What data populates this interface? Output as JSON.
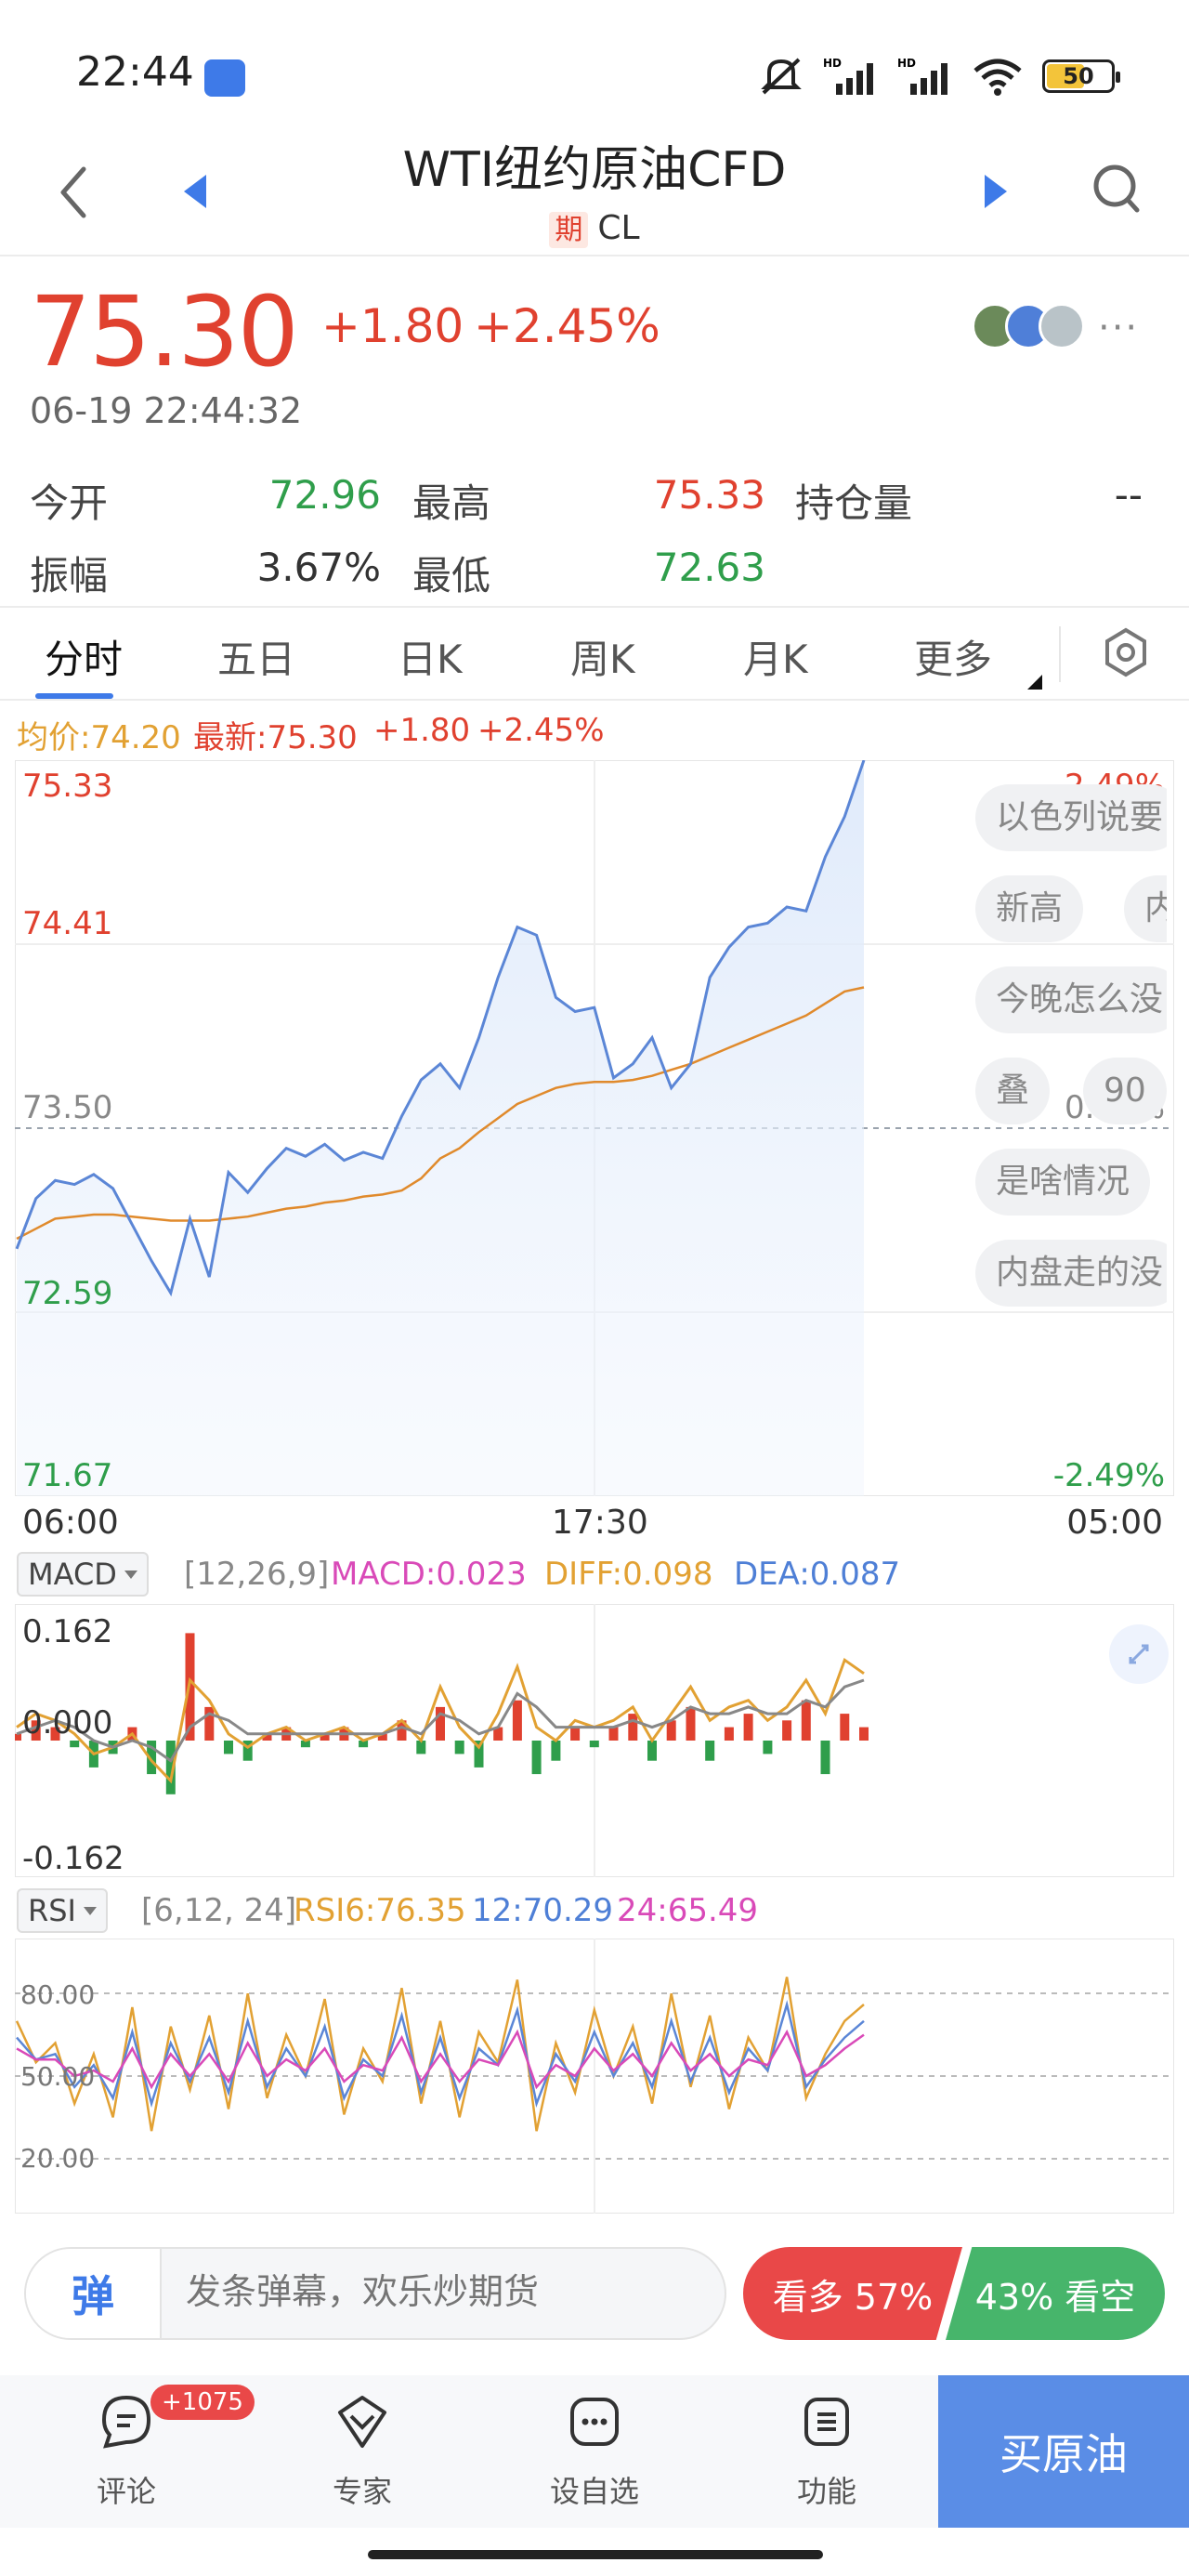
{
  "status_bar": {
    "time": "22:44",
    "battery": "50",
    "icons": [
      "mute-icon",
      "signal-hd-icon",
      "signal-hd-icon",
      "wifi-icon",
      "battery-icon"
    ]
  },
  "header": {
    "title": "WTI纽约原油CFD",
    "tag": "期",
    "code": "CL"
  },
  "quote": {
    "price": "75.30",
    "change": "+1.80",
    "change_pct": "+2.45%",
    "datetime": "06-19 22:44:32",
    "more": "···"
  },
  "stats": {
    "open_label": "今开",
    "open": "72.96",
    "high_label": "最高",
    "high": "75.33",
    "oi_label": "持仓量",
    "oi": "--",
    "amp_label": "振幅",
    "amp": "3.67%",
    "low_label": "最低",
    "low": "72.63"
  },
  "tabs": [
    {
      "label": "分时"
    },
    {
      "label": "五日"
    },
    {
      "label": "日K"
    },
    {
      "label": "周K"
    },
    {
      "label": "月K"
    },
    {
      "label": "更多"
    }
  ],
  "legend": {
    "avg": "均价:74.20",
    "latest": "最新:75.30",
    "change": "+1.80",
    "change_pct": "+2.45%"
  },
  "main_axis": {
    "y_left": [
      "75.33",
      "74.41",
      "73.50",
      "72.59",
      "71.67"
    ],
    "y_right_top": "2.49%",
    "y_right_mid": "0.00%",
    "y_right_bottom": "-2.49%",
    "x": [
      "06:00",
      "17:30",
      "05:00"
    ]
  },
  "macd": {
    "name": "MACD",
    "params": "[12,26,9]",
    "macd": "MACD:0.023",
    "diff": "DIFF:0.098",
    "dea": "DEA:0.087",
    "y_top": "0.162",
    "y_mid": "0.000",
    "y_bottom": "-0.162"
  },
  "rsi": {
    "name": "RSI",
    "params": "[6,12, 24]",
    "rsi6": "RSI6:76.35",
    "rsi12": "12:70.29",
    "rsi24": "24:65.49",
    "y_top": "80.00",
    "y_mid": "50.00",
    "y_bottom": "20.00"
  },
  "danmaku": [
    "以色列说要",
    "新高",
    "内",
    "今晚怎么没",
    "叠",
    "90",
    "是啥情况",
    "内盘走的没"
  ],
  "bottom_bar": {
    "danmaku_icon": "弹",
    "input_placeholder": "发条弹幕，欢乐炒期货",
    "bull": "看多 57%",
    "bear": "43% 看空"
  },
  "nav": {
    "comment": "评论",
    "comment_badge": "+1075",
    "expert": "专家",
    "watchlist": "设自选",
    "function": "功能",
    "buy": "买原油"
  },
  "colors": {
    "up": "#e0412f",
    "down": "#2f9e4b",
    "price_line": "#5b86d6",
    "avg_line": "#e08a2c",
    "accent": "#3e7ae8"
  },
  "chart_data": [
    {
      "type": "line",
      "title": "",
      "series": [
        {
          "name": "最新",
          "values": [
            72.9,
            73.15,
            73.24,
            73.22,
            73.27,
            73.2,
            73.02,
            72.84,
            72.68,
            73.05,
            72.76,
            73.28,
            73.18,
            73.3,
            73.4,
            73.36,
            73.42,
            73.34,
            73.38,
            73.35,
            73.56,
            73.74,
            73.82,
            73.7,
            73.95,
            74.25,
            74.5,
            74.46,
            74.15,
            74.08,
            74.1,
            73.75,
            73.82,
            73.95,
            73.7,
            73.82,
            74.25,
            74.4,
            74.5,
            74.52,
            74.6,
            74.58,
            74.85,
            75.05,
            75.33
          ]
        },
        {
          "name": "均价",
          "values": [
            72.95,
            73.0,
            73.05,
            73.06,
            73.07,
            73.07,
            73.06,
            73.05,
            73.04,
            73.04,
            73.04,
            73.05,
            73.06,
            73.08,
            73.1,
            73.11,
            73.13,
            73.14,
            73.16,
            73.17,
            73.19,
            73.25,
            73.35,
            73.4,
            73.48,
            73.55,
            73.62,
            73.66,
            73.7,
            73.72,
            73.73,
            73.73,
            73.74,
            73.76,
            73.79,
            73.82,
            73.86,
            73.9,
            73.94,
            73.98,
            74.02,
            74.06,
            74.12,
            74.18,
            74.2
          ]
        }
      ],
      "ylim": [
        71.67,
        75.33
      ],
      "x_ticks": [
        "06:00",
        "17:30",
        "05:00"
      ]
    },
    {
      "type": "bar",
      "title": "MACD",
      "series": [
        {
          "name": "MACD",
          "values": [
            0.01,
            0.03,
            0.02,
            -0.01,
            -0.04,
            -0.02,
            0.02,
            -0.05,
            -0.08,
            0.16,
            0.05,
            -0.02,
            -0.03,
            0.01,
            0.02,
            -0.01,
            0.01,
            0.02,
            -0.01,
            0.01,
            0.03,
            -0.02,
            0.05,
            -0.02,
            -0.04,
            0.02,
            0.06,
            -0.05,
            -0.03,
            0.02,
            -0.01,
            0.02,
            0.04,
            -0.03,
            0.03,
            0.05,
            -0.03,
            0.02,
            0.04,
            -0.02,
            0.03,
            0.06,
            -0.05,
            0.04,
            0.02
          ]
        },
        {
          "name": "DIFF",
          "values": [
            0.02,
            0.04,
            0.03,
            0.01,
            -0.02,
            -0.01,
            0.01,
            -0.03,
            -0.06,
            0.09,
            0.06,
            0.01,
            -0.01,
            0.01,
            0.02,
            0.0,
            0.01,
            0.02,
            0.0,
            0.01,
            0.03,
            0.0,
            0.08,
            0.02,
            -0.01,
            0.04,
            0.11,
            0.02,
            0.0,
            0.03,
            0.02,
            0.03,
            0.05,
            0.0,
            0.04,
            0.08,
            0.03,
            0.05,
            0.06,
            0.03,
            0.05,
            0.09,
            0.04,
            0.12,
            0.1
          ]
        },
        {
          "name": "DEA",
          "values": [
            0.01,
            0.02,
            0.03,
            0.02,
            0.0,
            -0.01,
            0.0,
            -0.01,
            -0.03,
            0.02,
            0.04,
            0.03,
            0.01,
            0.01,
            0.01,
            0.01,
            0.01,
            0.01,
            0.01,
            0.01,
            0.02,
            0.01,
            0.04,
            0.03,
            0.01,
            0.02,
            0.07,
            0.05,
            0.02,
            0.02,
            0.02,
            0.02,
            0.03,
            0.02,
            0.03,
            0.05,
            0.04,
            0.04,
            0.05,
            0.04,
            0.04,
            0.06,
            0.05,
            0.08,
            0.09
          ]
        }
      ],
      "ylim": [
        -0.162,
        0.162
      ]
    },
    {
      "type": "line",
      "title": "RSI",
      "series": [
        {
          "name": "RSI6",
          "values": [
            70,
            55,
            62,
            40,
            58,
            35,
            75,
            30,
            68,
            45,
            72,
            38,
            80,
            42,
            65,
            50,
            78,
            36,
            60,
            48,
            82,
            40,
            70,
            35,
            66,
            55,
            85,
            30,
            62,
            44,
            74,
            50,
            68,
            40,
            80,
            46,
            72,
            38,
            64,
            52,
            86,
            42,
            58,
            70,
            76
          ]
        },
        {
          "name": "RSI12",
          "values": [
            64,
            56,
            58,
            46,
            54,
            42,
            66,
            40,
            62,
            48,
            64,
            44,
            70,
            46,
            60,
            50,
            68,
            42,
            56,
            50,
            72,
            44,
            64,
            42,
            60,
            54,
            74,
            40,
            58,
            48,
            66,
            50,
            62,
            46,
            70,
            48,
            64,
            44,
            60,
            52,
            76,
            46,
            56,
            64,
            70
          ]
        },
        {
          "name": "RSI24",
          "values": [
            60,
            56,
            56,
            50,
            52,
            48,
            60,
            46,
            58,
            50,
            58,
            48,
            62,
            50,
            56,
            52,
            60,
            48,
            54,
            52,
            64,
            48,
            58,
            48,
            56,
            54,
            66,
            46,
            54,
            50,
            60,
            52,
            58,
            50,
            62,
            52,
            58,
            50,
            56,
            54,
            66,
            50,
            54,
            60,
            65
          ]
        }
      ],
      "ylim": [
        0,
        100
      ]
    }
  ]
}
